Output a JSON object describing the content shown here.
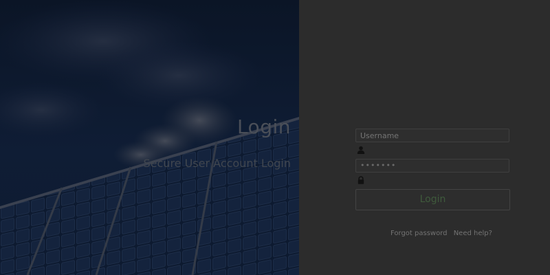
{
  "hero": {
    "title": "Login",
    "subtitle": "Secure User Account Login",
    "background": "solar-panels-sky-photo"
  },
  "form": {
    "username": {
      "placeholder": "Username",
      "value": "",
      "icon": "user-icon"
    },
    "password": {
      "value": "•••••••",
      "icon": "lock-icon"
    },
    "login_label": "Login"
  },
  "links": {
    "forgot": "Forgot password",
    "help": "Need help?"
  },
  "colors": {
    "panel_bg": "#2c2c2c",
    "hero_bg": "#0f1d35",
    "button_text": "#3f5a3c"
  }
}
